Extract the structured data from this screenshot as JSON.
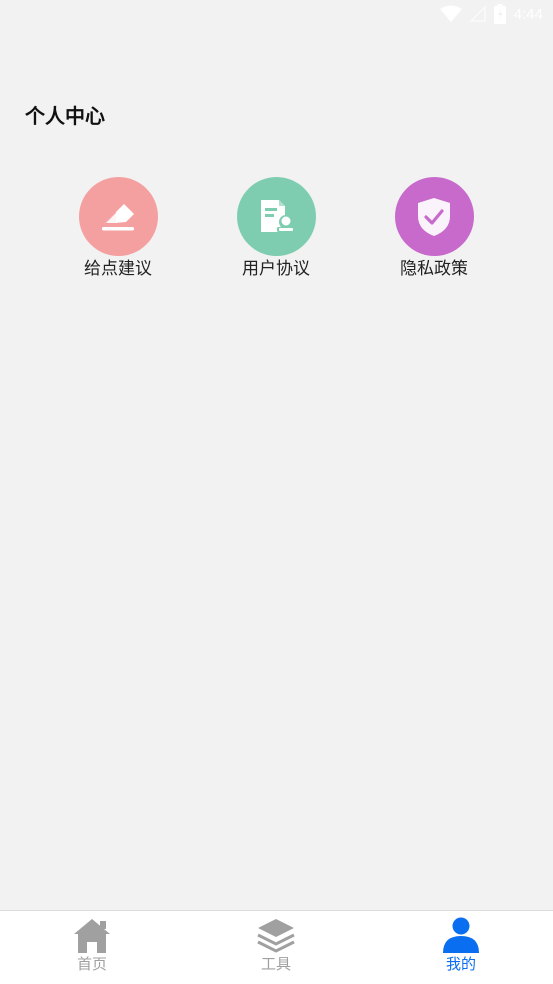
{
  "status_bar": {
    "time": "4:44"
  },
  "page": {
    "title": "个人中心"
  },
  "menu": [
    {
      "label": "给点建议",
      "icon": "feedback-envelope-icon",
      "color": "#f4a0a0"
    },
    {
      "label": "用户协议",
      "icon": "agreement-document-icon",
      "color": "#7fcdb1"
    },
    {
      "label": "隐私政策",
      "icon": "privacy-shield-icon",
      "color": "#c76acb"
    }
  ],
  "bottom_nav": {
    "tabs": [
      {
        "label": "首页",
        "icon": "home-icon",
        "active": false
      },
      {
        "label": "工具",
        "icon": "layers-icon",
        "active": false
      },
      {
        "label": "我的",
        "icon": "user-icon",
        "active": true
      }
    ],
    "active_color": "#0a6ef0",
    "inactive_color": "#a0a0a0"
  }
}
